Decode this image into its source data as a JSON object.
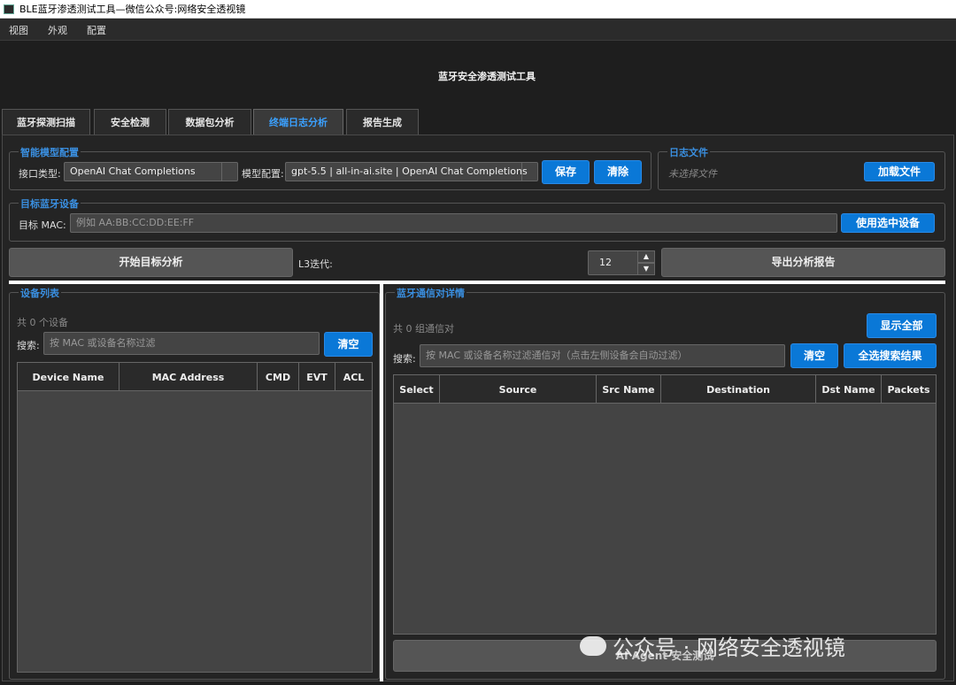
{
  "window": {
    "title": "BLE蓝牙渗透测试工具—微信公众号:网络安全透视镜"
  },
  "menu": [
    "视图",
    "外观",
    "配置"
  ],
  "app_title": "蓝牙安全渗透测试工具",
  "tabs": [
    "蓝牙探测扫描",
    "安全检测",
    "数据包分析",
    "终端日志分析",
    "报告生成"
  ],
  "active_tab": "终端日志分析",
  "ai_config": {
    "title": "智能模型配置",
    "interface_label": "接口类型:",
    "interface_value": "OpenAI Chat Completions",
    "model_label": "模型配置:",
    "model_value": "gpt-5.5 | all-in-ai.site | OpenAI Chat Completions",
    "save": "保存",
    "clear": "清除"
  },
  "log_file": {
    "title": "日志文件",
    "placeholder": "未选择文件",
    "load": "加载文件"
  },
  "target": {
    "title": "目标蓝牙设备",
    "mac_label": "目标 MAC:",
    "mac_placeholder": "例如 AA:BB:CC:DD:EE:FF",
    "use_selected": "使用选中设备"
  },
  "actions": {
    "start": "开始目标分析",
    "l3_label": "L3迭代:",
    "l3_value": "12",
    "export": "导出分析报告"
  },
  "devices": {
    "title": "设备列表",
    "count": "共 0 个设备",
    "search_label": "搜索:",
    "search_placeholder": "按 MAC 或设备名称过滤",
    "clear": "清空",
    "columns": [
      "Device Name",
      "MAC Address",
      "CMD",
      "EVT",
      "ACL"
    ]
  },
  "pairs": {
    "title": "蓝牙通信对详情",
    "count": "共 0 组通信对",
    "show_all": "显示全部",
    "search_label": "搜索:",
    "search_placeholder": "按 MAC 或设备名称过滤通信对（点击左侧设备会自动过滤）",
    "clear": "清空",
    "select_all": "全选搜索结果",
    "columns": [
      "Select",
      "Source",
      "Src Name",
      "Destination",
      "Dst Name",
      "Packets"
    ],
    "agent_button": "AI Agent 安全测试"
  },
  "watermark": "公众号 · 网络安全透视镜"
}
